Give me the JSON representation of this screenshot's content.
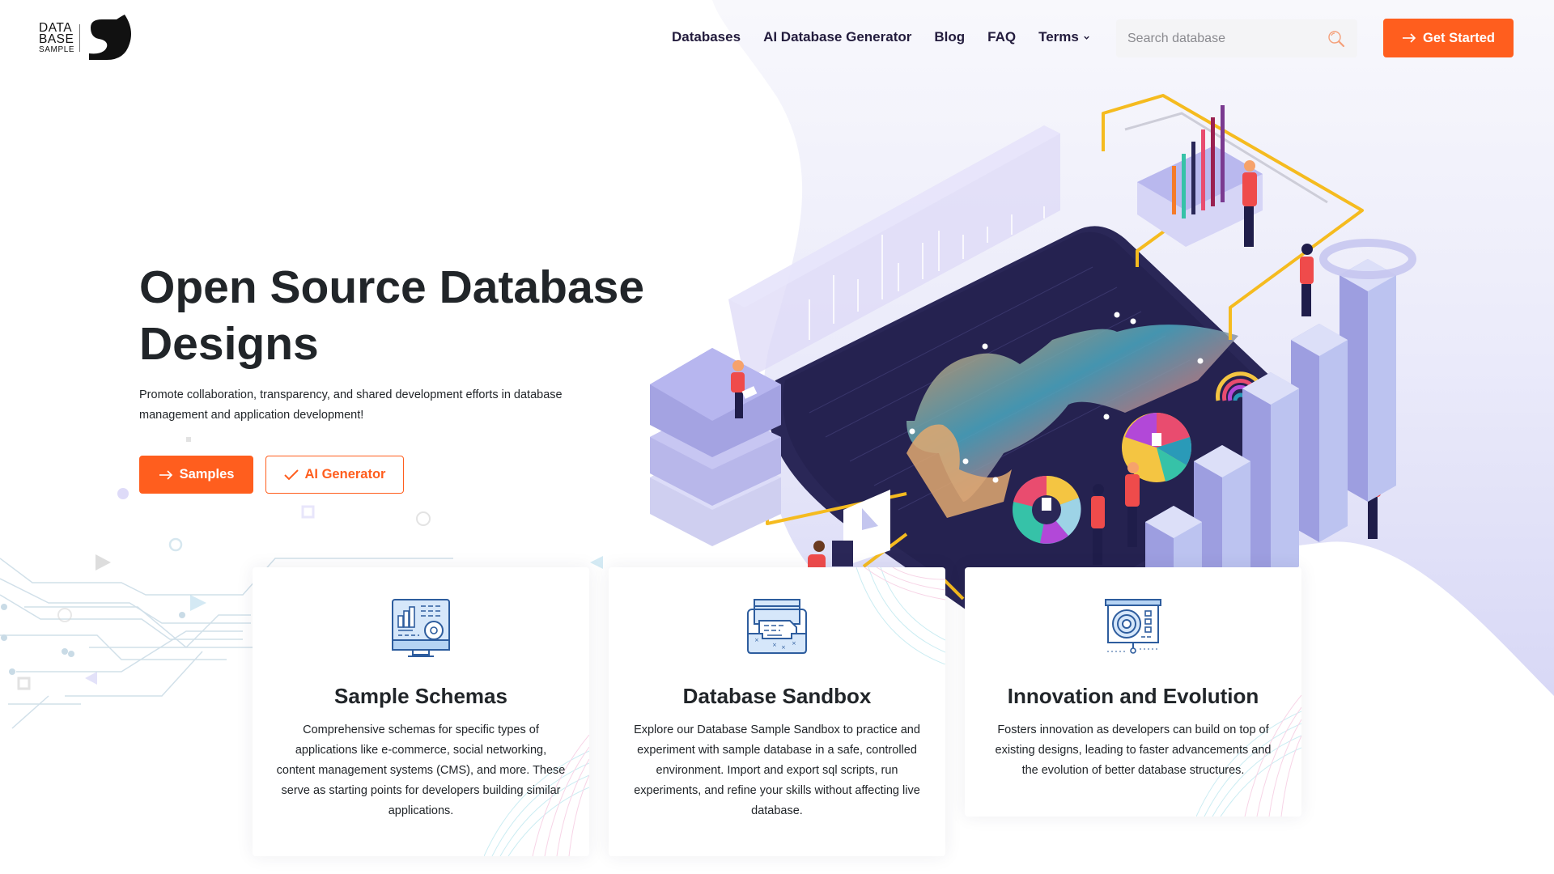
{
  "brand": {
    "logo_lines": [
      "DATA",
      "BASE",
      "SAMPLE"
    ]
  },
  "nav": {
    "items": [
      {
        "label": "Databases"
      },
      {
        "label": "AI Database Generator"
      },
      {
        "label": "Blog"
      },
      {
        "label": "FAQ"
      },
      {
        "label": "Terms",
        "has_dropdown": true
      }
    ]
  },
  "search": {
    "placeholder": "Search database",
    "value": ""
  },
  "header_cta": {
    "label": "Get Started",
    "icon": "arrow-right-icon"
  },
  "hero": {
    "title": "Open Source Database Designs",
    "subtitle": "Promote collaboration, transparency, and shared development efforts in database management and application development!",
    "buttons": [
      {
        "label": "Samples",
        "icon": "arrow-right-icon",
        "style": "primary"
      },
      {
        "label": "AI Generator",
        "icon": "check-icon",
        "style": "outline"
      }
    ],
    "illustration": "isometric-data-analytics-illustration"
  },
  "features": [
    {
      "icon": "dashboard-monitor-icon",
      "title": "Sample Schemas",
      "text": "Comprehensive schemas for specific types of applications like e-commerce, social networking, content management systems (CMS), and more. These serve as starting points for developers building similar applications."
    },
    {
      "icon": "sandbox-tray-icon",
      "title": "Database Sandbox",
      "text": "Explore our Database Sample Sandbox to practice and experiment with sample database in a safe, controlled environment. Import and export sql scripts, run experiments, and refine your skills without affecting live database."
    },
    {
      "icon": "presentation-target-icon",
      "title": "Innovation and Evolution",
      "text": "Fosters innovation as developers can build on top of existing designs, leading to faster advancements and the evolution of better database structures."
    }
  ],
  "colors": {
    "accent": "#ff5e1e",
    "nav_text": "#231c3d",
    "heading": "#212529",
    "wave": "#dcdcf7",
    "illustration_board": "#2a2757"
  }
}
